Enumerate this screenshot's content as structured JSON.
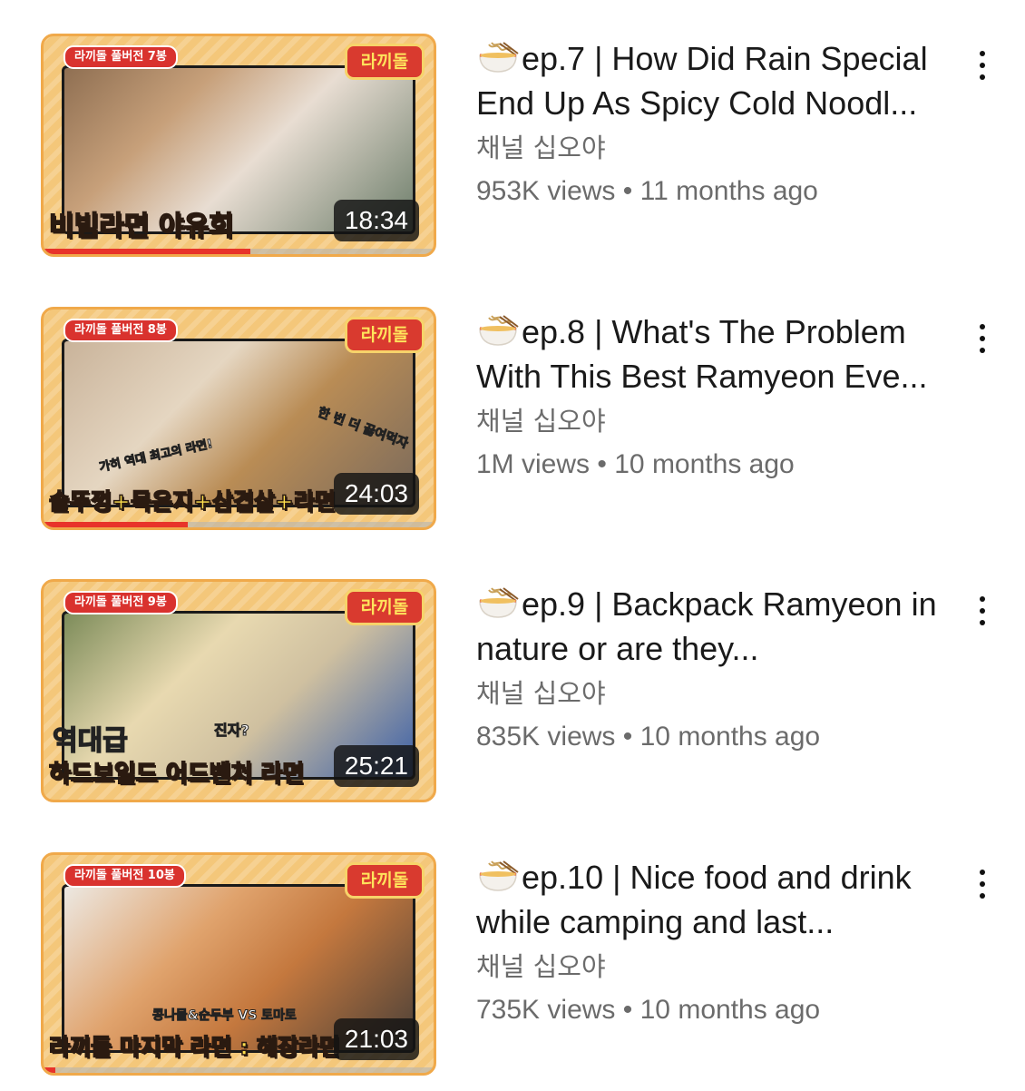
{
  "videos": [
    {
      "title": "ep.7 | How Did Rain Special End Up As Spicy Cold Noodl...",
      "channel": "채널 십오야",
      "views": "953K views",
      "age": "11 months ago",
      "duration": "18:34",
      "thumb_tag": "라끼돌 풀버전 7봉",
      "thumb_logo": "라끼돌",
      "thumb_caption": "비빔라면 야유회",
      "watch_progress": 0.53
    },
    {
      "title": "ep.8 | What's The Problem With This Best Ramyeon Eve...",
      "channel": "채널 십오야",
      "views": "1M views",
      "age": "10 months ago",
      "duration": "24:03",
      "thumb_tag": "라끼돌 풀버전 8봉",
      "thumb_logo": "라끼돌",
      "thumb_caption": "솥뚜껑+묵은지+삼겹살+라면",
      "thumb_overlay_1": "가히 역대 최고의 라면!",
      "thumb_overlay_2": "한 번 더 끓여먹자",
      "watch_progress": 0.37
    },
    {
      "title": "ep.9 | Backpack Ramyeon in nature or are they...",
      "channel": "채널 십오야",
      "views": "835K views",
      "age": "10 months ago",
      "duration": "25:21",
      "thumb_tag": "라끼돌 풀버전 9봉",
      "thumb_logo": "라끼돌",
      "thumb_caption": "하드보일드 어드벤처 라면",
      "thumb_overlay_1": "역대급",
      "thumb_overlay_2": "진자?",
      "watch_progress": 0.0
    },
    {
      "title": "ep.10 | Nice food and drink while camping and last...",
      "channel": "채널 십오야",
      "views": "735K views",
      "age": "10 months ago",
      "duration": "21:03",
      "thumb_tag": "라끼돌 풀버전 10봉",
      "thumb_logo": "라끼돌",
      "thumb_caption": "라끼돌 마지막 라면 : 해장라면",
      "thumb_overlay_1": "콩나물&순두부 VS 토마토",
      "watch_progress": 0.03
    }
  ],
  "separator": "•",
  "icons": {
    "title_emoji": "noodle-bowl-icon",
    "menu": "more-vertical-icon"
  },
  "colors": {
    "progress": "#e8332a",
    "text": "#1a1a1a",
    "secondary_text": "#6b6b6b"
  }
}
